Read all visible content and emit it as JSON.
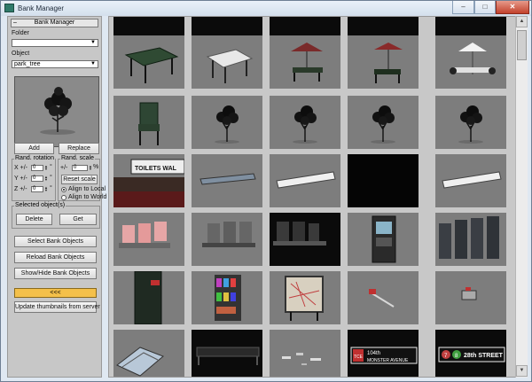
{
  "window": {
    "title": "Bank Manager",
    "controls": {
      "minimize": "–",
      "maximize": "□",
      "close": "✕"
    }
  },
  "panel": {
    "header": "Bank Manager",
    "collapse_mark": "–",
    "folder": {
      "label": "Folder",
      "value": ""
    },
    "object": {
      "label": "Object",
      "value": "park_tree"
    },
    "add_label": "Add",
    "replace_label": "Replace",
    "rand_rotation": {
      "title": "Rand. rotation",
      "x_label": "X +/-",
      "x_value": "0",
      "y_label": "Y +/-",
      "y_value": "0",
      "z_label": "Z +/-",
      "z_value": "0",
      "unit": "°"
    },
    "rand_scale": {
      "title": "Rand. scale",
      "label": "+/-",
      "value": "0",
      "unit": "%",
      "reset_label": "Reset scale",
      "align_local": "Align to Local",
      "align_world": "Align to World",
      "selected_align": "local"
    },
    "selected": {
      "title": "Selected object(s)",
      "delete_label": "Delete",
      "get_label": "Get"
    },
    "select_bank_label": "Select Bank Objects",
    "reload_bank_label": "Reload Bank Objects",
    "show_hide_label": "Show/Hide Bank Objects",
    "collapse_label": "<<<",
    "update_thumbs_label": "Update thumbnails from server"
  },
  "grid": {
    "thumbnails": [
      {
        "kind": "dark-partial"
      },
      {
        "kind": "dark-partial"
      },
      {
        "kind": "dark-partial"
      },
      {
        "kind": "dark-partial"
      },
      {
        "kind": "dark-partial"
      },
      {
        "kind": "table-green"
      },
      {
        "kind": "table-white"
      },
      {
        "kind": "umbrella-set-red"
      },
      {
        "kind": "umbrella-set-red-2"
      },
      {
        "kind": "umbrella-set-white"
      },
      {
        "kind": "chair-green"
      },
      {
        "kind": "tree"
      },
      {
        "kind": "tree"
      },
      {
        "kind": "tree"
      },
      {
        "kind": "tree"
      },
      {
        "kind": "toilets-sign",
        "sign_text": "TOILETS WAL"
      },
      {
        "kind": "bar-blue"
      },
      {
        "kind": "bar-white"
      },
      {
        "kind": "blank-dark"
      },
      {
        "kind": "bar-white"
      },
      {
        "kind": "seats-red"
      },
      {
        "kind": "seats-dark"
      },
      {
        "kind": "seats-dark-2"
      },
      {
        "kind": "atm"
      },
      {
        "kind": "turnstiles"
      },
      {
        "kind": "door-red"
      },
      {
        "kind": "newsstand"
      },
      {
        "kind": "map-board"
      },
      {
        "kind": "small-red"
      },
      {
        "kind": "small-cart"
      },
      {
        "kind": "cart-blue"
      },
      {
        "kind": "rail-dark"
      },
      {
        "kind": "debris"
      },
      {
        "kind": "street-sign",
        "line1": "104th",
        "line2": "MONSTER AVENUE",
        "logo": "TCE"
      },
      {
        "kind": "street-sign-2",
        "line1": "28th STREET",
        "badges": [
          "7",
          "8"
        ]
      }
    ]
  }
}
